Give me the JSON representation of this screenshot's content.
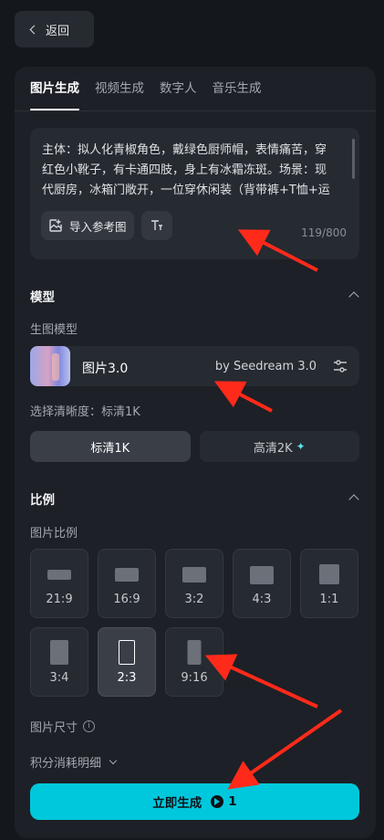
{
  "back": {
    "label": "返回"
  },
  "tabs": [
    {
      "label": "图片生成",
      "active": true
    },
    {
      "label": "视频生成",
      "active": false
    },
    {
      "label": "数字人",
      "active": false
    },
    {
      "label": "音乐生成",
      "active": false
    }
  ],
  "prompt": {
    "text": "主体：拟人化青椒角色，戴绿色厨师帽，表情痛苦，穿红色小靴子，有卡通四肢，身上有冰霜冻斑。场景：现代厨房，冰箱门敞开，一位穿休闲装（背带裤+T恤+运动鞋）的女士惊讶地看着冰箱",
    "import_label": "导入参考图",
    "counter": "119/800",
    "import_icon": "image-import-icon",
    "text_icon": "text-format-icon"
  },
  "model_section": {
    "title": "模型",
    "sub_label": "生图模型",
    "model_name": "图片3.0",
    "model_by": "by Seedream 3.0",
    "settings_icon": "sliders-icon",
    "resolution_label": "选择清晰度：标清1K",
    "resolutions": [
      {
        "label": "标清1K",
        "active": true
      },
      {
        "label": "高清2K",
        "active": false,
        "badge": "✦"
      }
    ]
  },
  "ratio_section": {
    "title": "比例",
    "sub_label": "图片比例",
    "ratios": [
      {
        "label": "21:9",
        "active": false
      },
      {
        "label": "16:9",
        "active": false
      },
      {
        "label": "3:2",
        "active": false
      },
      {
        "label": "4:3",
        "active": false
      },
      {
        "label": "1:1",
        "active": false
      },
      {
        "label": "3:4",
        "active": false
      },
      {
        "label": "2:3",
        "active": true
      },
      {
        "label": "9:16",
        "active": false
      }
    ]
  },
  "size_label": "图片尺寸",
  "info_glyph": "i",
  "cost_label": "积分消耗明细",
  "generate": {
    "label": "立即生成",
    "cost": "1"
  },
  "colors": {
    "accent": "#00c8dc",
    "annotation_arrow": "#ff2a1a",
    "background": "#14171c",
    "panel": "#1d2026"
  }
}
